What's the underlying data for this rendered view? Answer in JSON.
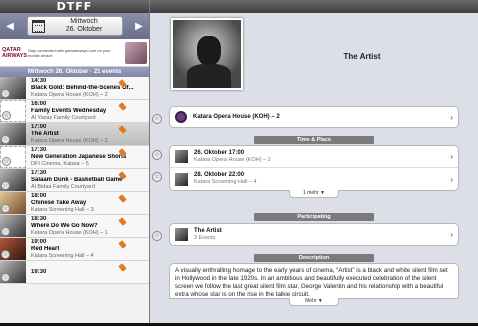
{
  "app": {
    "title": "DTFF"
  },
  "date_nav": {
    "prev": "◀",
    "next": "▶",
    "weekday": "Mittwoch",
    "date": "26. Oktober"
  },
  "ad": {
    "brand": "QATAR AIRWAYS",
    "text": "Stay connected with qatarairways.com on your mobile device."
  },
  "list_header": "Mittwoch 26. Oktober · 21 events",
  "events": [
    {
      "time": "14:30",
      "title": "Black Gold: Behind-the-Scenes Of...",
      "location": "Katara Opera House (KOH) – 2",
      "thumb": "t-bw"
    },
    {
      "time": "16:00",
      "title": "Family Events Wednesday",
      "location": "Al Yazaz Family Courtyard",
      "thumb": "t-film"
    },
    {
      "time": "17:00",
      "title": "The Artist",
      "location": "Katara Opera House (KOH) – 2",
      "thumb": "t-bw",
      "selected": true
    },
    {
      "time": "17:30",
      "title": "New Generation Japanese Shorts",
      "location": "DFI Cinema, Katara – 5",
      "thumb": "t-film"
    },
    {
      "time": "17:30",
      "title": "Salaam Dunk - Basketball Game",
      "location": "Al Bidaa Family Courtyard",
      "thumb": "t-bw"
    },
    {
      "time": "18:00",
      "title": "Chinese Take Away",
      "location": "Katara Screening Hall – 3",
      "thumb": "t-cr"
    },
    {
      "time": "18:30",
      "title": "Where Do We Go Now?",
      "location": "Katara Opera House (KOH) – 1",
      "thumb": "t-bw"
    },
    {
      "time": "19:00",
      "title": "Red Heart",
      "location": "Katara Screening Hall – 4",
      "thumb": "t-red"
    },
    {
      "time": "19:30",
      "title": "",
      "location": "",
      "thumb": "t-bw"
    }
  ],
  "detail": {
    "title": "The Artist",
    "venue": "Katara Opera House (KOH) – 2",
    "time_place_label": "Time & Place",
    "showings": [
      {
        "date": "26. Oktober 17:00",
        "venue": "Katara Opera House (KOH) – 2"
      },
      {
        "date": "28. Oktober 22:00",
        "venue": "Katara Screening Hall – 4"
      }
    ],
    "more_showings": "1 mehr ▼",
    "participating_label": "Participating",
    "participating": {
      "name": "The Artist",
      "events": "3 Events"
    },
    "description_label": "Description",
    "description": "A visually enthralling homage to the early years of cinema, “Artist” is a black and white silent film set in Hollywood in the late 1920s. In an ambitious and beautifully executed celebration of the silent screen we follow the last great silent film star, George Valentin and his relationship with a beautiful extra whose star is on the rise in the talkie circuit.",
    "more_description": "Mehr ▼"
  },
  "icons": {
    "star": "☆",
    "chevron": "›"
  }
}
